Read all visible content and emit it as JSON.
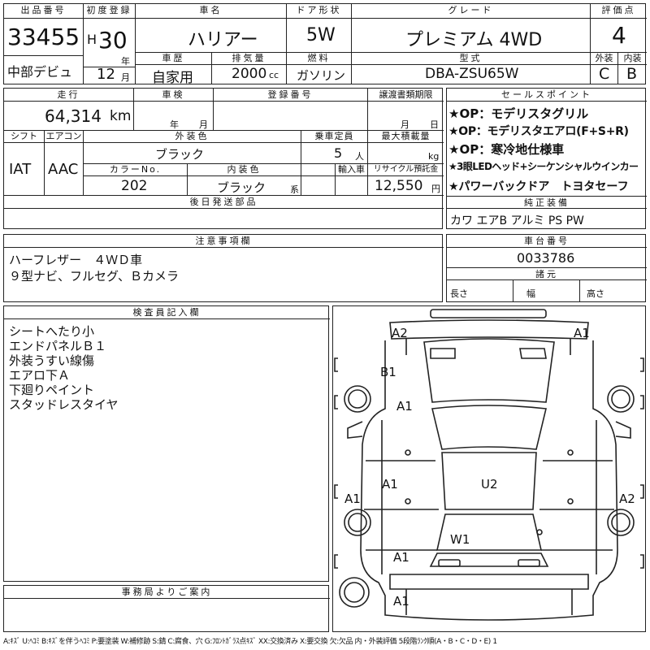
{
  "headers": {
    "lot_no": "出品番号",
    "first_reg": "初度登録",
    "car_name": "車名",
    "door": "ドア形状",
    "grade": "グレード",
    "score": "評価点",
    "car_history": "車歴",
    "displacement": "排気量",
    "fuel": "燃料",
    "model_code": "型式",
    "exterior": "外装",
    "interior": "内装",
    "mileage": "走行",
    "inspection": "車検",
    "reg_no": "登録番号",
    "transfer_docs": "譲渡書類期限",
    "sales_points": "セールスポイント",
    "shift": "シフト",
    "aircon": "エアコン",
    "ext_color": "外装色",
    "capacity": "乗車定員",
    "max_load": "最大積載量",
    "color_no": "カラーNo.",
    "int_color": "内装色",
    "import": "輸入車",
    "recycle": "リサイクル預託金",
    "later_parts": "後日発送部品",
    "genuine": "純正装備",
    "notes": "注意事項欄",
    "chassis_no": "車台番号",
    "dimensions": "諸元",
    "inspector": "検査員記入欄",
    "office": "事務局よりご案内"
  },
  "values": {
    "lot_no": "33455",
    "venue": "中部デビュ",
    "era": "H",
    "year": "30",
    "year_unit": "年",
    "month": "12",
    "month_unit": "月",
    "car_name": "ハリアー",
    "door": "5W",
    "grade": "プレミアム 4WD",
    "score": "4",
    "car_history": "自家用",
    "displacement": "2000",
    "cc": "cc",
    "fuel": "ガソリン",
    "model_code": "DBA-ZSU65W",
    "ext_grade": "C",
    "int_grade": "B",
    "mileage": "64,314",
    "km": "km",
    "insp_year": "年",
    "insp_month": "月",
    "doc_month": "月",
    "doc_day": "日",
    "shift": "IAT",
    "aircon": "AAC",
    "ext_color": "ブラック",
    "capacity": "5",
    "capacity_unit": "人",
    "kg": "kg",
    "color_no": "202",
    "int_color": "ブラック",
    "int_suffix": "系",
    "recycle": "12,550",
    "yen": "円",
    "genuine": "カワ エアB アルミ PS PW",
    "chassis_no": "0033786",
    "length": "長さ",
    "width": "幅",
    "height": "高さ"
  },
  "sales_points": [
    "★OP：モデリスタグリル",
    "★OP：モデリスタエアロ(F+S+R)",
    "★OP：寒冷地仕様車",
    "★3眼LEDヘッド+シーケンシャルウインカー",
    "★パワーバックドア　トヨタセーフ"
  ],
  "notes": [
    "ハーフレザー　４ＷＤ車",
    "９型ナビ、フルセグ、Ｂカメラ"
  ],
  "inspector": [
    "シートへたり小",
    "エンドパネルＢ１",
    "外装うすい線傷",
    "エアロ下Ａ",
    "下廻りペイント",
    "スタッドレスタイヤ"
  ],
  "diagram_marks": {
    "a2_top": "A2",
    "a1_top": "A1",
    "b1": "B1",
    "a1_hood": "A1",
    "a1_left_side": "A1",
    "a1_left_front": "A1",
    "u2": "U2",
    "a2_right": "A2",
    "w1": "W1",
    "a1_rear": "A1",
    "a1_bottom": "A1"
  },
  "footer": "A:ｷｽﾞ U:ﾍｺﾐ B:ｷｽﾞを伴うﾍｺﾐ P:要塗装 W:補修跡 S:錆 C:腐食、穴 G:ﾌﾛﾝﾄｶﾞﾗｽ点ｷｽﾞ XX:交換済み X:要交換 欠:欠品 内・外装評価 5段階ﾗﾝｸ順(A・B・C・D・E) 1"
}
